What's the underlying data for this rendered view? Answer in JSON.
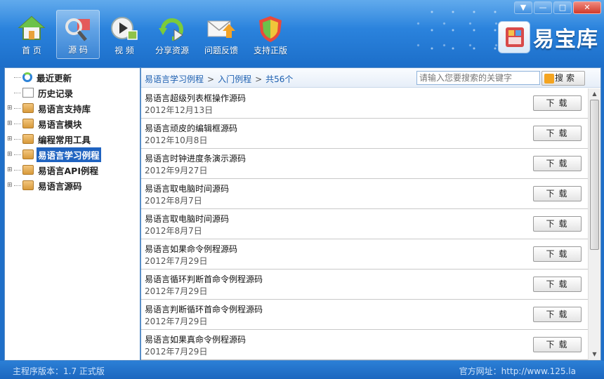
{
  "toolbar": [
    {
      "label": "首 页",
      "icon": "home-icon"
    },
    {
      "label": "源 码",
      "icon": "source-code-icon",
      "active": true
    },
    {
      "label": "视 频",
      "icon": "video-icon"
    },
    {
      "label": "分享资源",
      "icon": "share-icon"
    },
    {
      "label": "问题反馈",
      "icon": "feedback-mail-icon"
    },
    {
      "label": "支持正版",
      "icon": "shield-icon"
    }
  ],
  "window_controls": {
    "menu": "▼",
    "minimize": "—",
    "maximize": "□",
    "close": "✕"
  },
  "logo": {
    "text": "易宝库"
  },
  "tree": [
    {
      "label": "最近更新",
      "icon": "refresh-icon"
    },
    {
      "label": "历史记录",
      "icon": "document-icon"
    },
    {
      "label": "易语言支持库",
      "icon": "folder-icon",
      "expand": "⊞"
    },
    {
      "label": "易语言模块",
      "icon": "folder-icon",
      "expand": "⊞"
    },
    {
      "label": "编程常用工具",
      "icon": "folder-icon",
      "expand": "⊞"
    },
    {
      "label": "易语言学习例程",
      "icon": "folder-icon",
      "expand": "⊞",
      "selected": true
    },
    {
      "label": "易语言API例程",
      "icon": "folder-icon",
      "expand": "⊞"
    },
    {
      "label": "易语言源码",
      "icon": "folder-icon",
      "expand": "⊞"
    }
  ],
  "breadcrumb": {
    "root": "易语言学习例程",
    "sep": ">",
    "child": "入门例程",
    "count": "共56个"
  },
  "search": {
    "placeholder": "请输入您要搜索的关键字",
    "button": "搜索"
  },
  "download_label": "下载",
  "items": [
    {
      "title": "易语言超级列表框操作源码",
      "date": "2012年12月13日"
    },
    {
      "title": "易语言顽皮的编辑框源码",
      "date": "2012年10月8日"
    },
    {
      "title": "易语言时钟进度条演示源码",
      "date": "2012年9月27日"
    },
    {
      "title": "易语言取电脑时间源码",
      "date": "2012年8月7日"
    },
    {
      "title": "易语言取电脑时间源码",
      "date": "2012年8月7日"
    },
    {
      "title": "易语言如果命令例程源码",
      "date": "2012年7月29日"
    },
    {
      "title": "易语言循环判断首命令例程源码",
      "date": "2012年7月29日"
    },
    {
      "title": "易语言判断循环首命令例程源码",
      "date": "2012年7月29日"
    },
    {
      "title": "易语言如果真命令例程源码",
      "date": "2012年7月29日"
    }
  ],
  "status": {
    "version": "主程序版本：1.7 正式版",
    "site": "官方网址：http://www.125.la"
  },
  "colors": {
    "accent": "#1f6fc8",
    "selected": "#1f63c0",
    "link": "#1c5fb0"
  }
}
